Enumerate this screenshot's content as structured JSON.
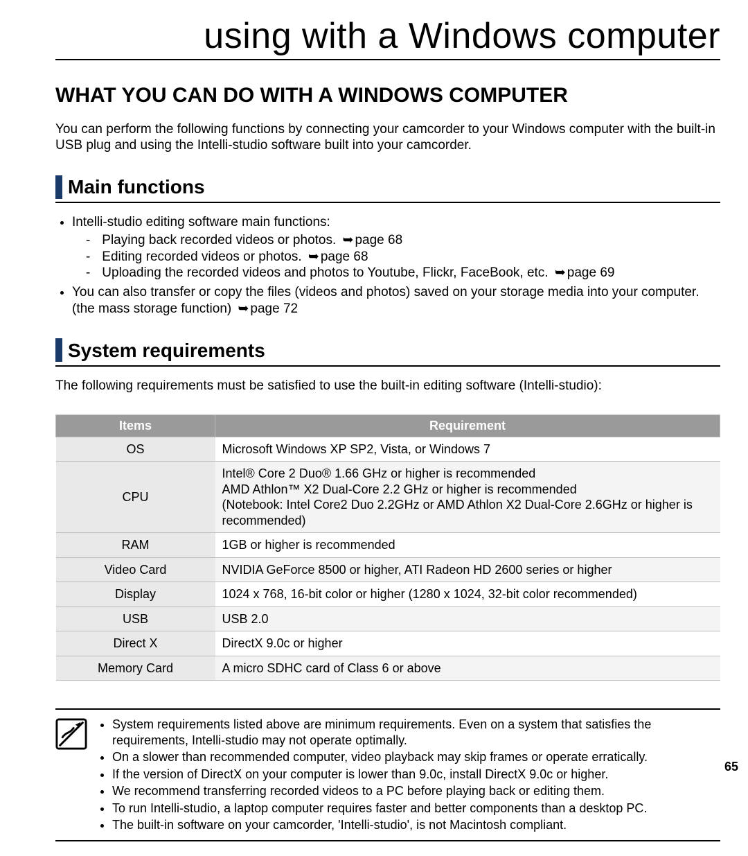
{
  "chapter_title": "using with a Windows computer",
  "section_title": "WHAT YOU CAN DO WITH A WINDOWS COMPUTER",
  "intro": "You can perform the following functions by connecting your camcorder to your Windows computer with the built-in USB plug and using the Intelli-studio software built into your camcorder.",
  "main_functions": {
    "heading": "Main functions",
    "bullets": [
      {
        "text": "Intelli-studio editing software main functions:",
        "sub": [
          {
            "text": "Playing back recorded videos or photos.",
            "pageref": "page 68"
          },
          {
            "text": "Editing recorded videos or photos.",
            "pageref": "page 68"
          },
          {
            "text": "Uploading the recorded videos and photos to Youtube, Flickr, FaceBook, etc.",
            "pageref": "page 69"
          }
        ]
      },
      {
        "text_a": "You can also transfer or copy the files (videos and photos) saved on your storage media into your computer. (the mass storage function)",
        "pageref": "page 72"
      }
    ]
  },
  "sysreq": {
    "heading": "System requirements",
    "intro": "The following requirements must be satisfied to use the built-in editing software (Intelli-studio):",
    "columns": {
      "items": "Items",
      "requirement": "Requirement"
    },
    "rows": [
      {
        "item": "OS",
        "req": "Microsoft Windows XP SP2, Vista, or Windows 7"
      },
      {
        "item": "CPU",
        "req": "Intel® Core 2 Duo® 1.66 GHz or higher is recommended\nAMD Athlon™ X2 Dual-Core 2.2 GHz or higher is recommended\n(Notebook: Intel Core2 Duo 2.2GHz or AMD Athlon X2 Dual-Core 2.6GHz or higher is recommended)"
      },
      {
        "item": "RAM",
        "req": "1GB or higher is recommended"
      },
      {
        "item": "Video Card",
        "req": "NVIDIA GeForce 8500 or higher, ATI Radeon HD 2600 series or higher"
      },
      {
        "item": "Display",
        "req": "1024 x 768, 16-bit color or higher (1280 x 1024, 32-bit color recommended)"
      },
      {
        "item": "USB",
        "req": "USB 2.0"
      },
      {
        "item": "Direct X",
        "req": "DirectX 9.0c or higher"
      },
      {
        "item": "Memory Card",
        "req": "A micro SDHC card of Class 6 or above"
      }
    ]
  },
  "notes": [
    "System requirements listed above are minimum requirements. Even on a system that satisfies the requirements, Intelli-studio may not operate optimally.",
    "On a slower than recommended computer, video playback may skip frames or operate erratically.",
    "If the version of DirectX on your computer is lower than 9.0c, install DirectX 9.0c or higher.",
    "We recommend transferring recorded videos to a PC before playing back or editing them.",
    "To run Intelli-studio, a laptop computer requires faster and better components than a desktop PC.",
    "The built-in software on your camcorder, 'Intelli-studio', is not Macintosh compliant."
  ],
  "page_number": "65"
}
